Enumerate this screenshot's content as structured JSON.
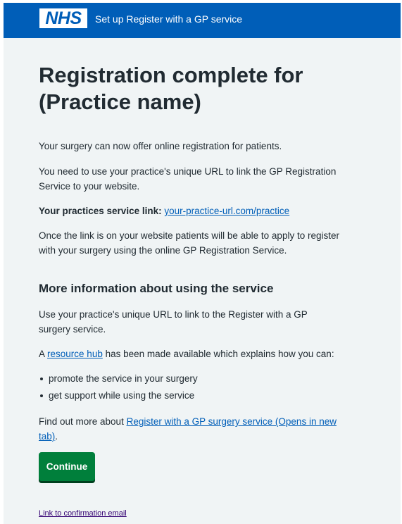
{
  "header": {
    "logo_text": "NHS",
    "service_name": "Set up Register with a GP service",
    "color": "#005eb8"
  },
  "main": {
    "title": "Registration complete for (Practice name)",
    "intro": "Your surgery can now offer online registration for patients.",
    "url_info": "You need to use your practice's unique URL to link the GP Registration Service to your website.",
    "service_link_label": "Your practices service link:",
    "service_link": "your-practice-url.com/practice",
    "patients_info": "Once the link is on your website patients will be able to apply to register with your surgery using the online GP Registration Service."
  },
  "more_info": {
    "heading": "More information about using the service",
    "para1": "Use your practice's unique URL to link to the Register with a GP surgery service.",
    "hub_prefix": "A",
    "hub_link": "resource hub",
    "hub_suffix": "has been made available which explains how you can:",
    "bullets": [
      "promote the service in your surgery",
      "get support while using the service"
    ],
    "find_out_prefix": "Find out more about",
    "find_out_link": "Register with a GP surgery service (Opens in new tab)",
    "find_out_suffix": "."
  },
  "actions": {
    "continue_label": "Continue",
    "continue_color": "#007f3b",
    "confirmation_link": "Link to confirmation email"
  }
}
